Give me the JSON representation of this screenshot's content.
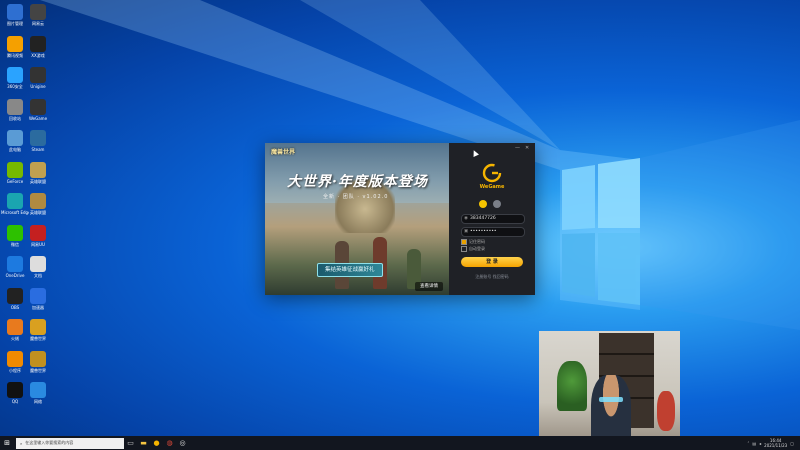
{
  "desktop": {
    "icons": [
      {
        "label": "图片管理",
        "icon": "image-icon",
        "color": "#2e6fd1"
      },
      {
        "label": "网易云",
        "icon": "tv-icon",
        "color": "#444"
      },
      {
        "label": "腾讯视频",
        "icon": "video-icon",
        "color": "#f5a000"
      },
      {
        "label": "XX游戏",
        "icon": "game-icon",
        "color": "#222"
      },
      {
        "label": "360安全",
        "icon": "shield-icon",
        "color": "#2aa3ff"
      },
      {
        "label": "Unigine",
        "icon": "app-icon",
        "color": "#333"
      },
      {
        "label": "回收站",
        "icon": "recycle-bin-icon",
        "color": "#888"
      },
      {
        "label": "WeGame",
        "icon": "wegame-icon",
        "color": "#333"
      },
      {
        "label": "此电脑",
        "icon": "computer-icon",
        "color": "#5a9bd5"
      },
      {
        "label": "Steam",
        "icon": "steam-icon",
        "color": "#2b6b9f"
      },
      {
        "label": "GeForce",
        "icon": "nvidia-icon",
        "color": "#76b900"
      },
      {
        "label": "英雄联盟",
        "icon": "lol-icon",
        "color": "#c0a050"
      },
      {
        "label": "Microsoft Edge",
        "icon": "edge-icon",
        "color": "#1aa5b0"
      },
      {
        "label": "英雄联盟",
        "icon": "lol-icon",
        "color": "#b08a40"
      },
      {
        "label": "微信",
        "icon": "wechat-icon",
        "color": "#2dc100"
      },
      {
        "label": "网易UU",
        "icon": "uu-icon",
        "color": "#c42020"
      },
      {
        "label": "OneDrive",
        "icon": "cloud-icon",
        "color": "#1d7ae0"
      },
      {
        "label": "文档",
        "icon": "doc-icon",
        "color": "#ddd"
      },
      {
        "label": "OBS",
        "icon": "obs-icon",
        "color": "#222"
      },
      {
        "label": "加速器",
        "icon": "accelerator-icon",
        "color": "#2a6de0"
      },
      {
        "label": "火绒",
        "icon": "fire-icon",
        "color": "#e87a1e"
      },
      {
        "label": "魔兽世界",
        "icon": "wow-icon",
        "color": "#d9a020"
      },
      {
        "label": "小程序",
        "icon": "app-icon",
        "color": "#f08a00"
      },
      {
        "label": "魔兽世界",
        "icon": "wow-icon",
        "color": "#c09020"
      },
      {
        "label": "QQ",
        "icon": "qq-icon",
        "color": "#111"
      },
      {
        "label": "网络",
        "icon": "network-icon",
        "color": "#2a8ae0"
      }
    ]
  },
  "login": {
    "banner_logo": "魔兽世界",
    "banner_title": "大世界·年度版本登场",
    "banner_subtitle": "全新 · 团队 · v1.02.0",
    "banner_promo": "集结英雄征战赢好礼",
    "banner_more": "查看详情",
    "brand": "WeGame",
    "account": "383447726",
    "password_mask": "••••••••••",
    "remember_label": "记住密码",
    "auto_login_label": "自动登录",
    "login_button": "登 录",
    "register_link": "注册账号  找回密码",
    "minimize": "—",
    "close": "✕",
    "accent": "#f5b400"
  },
  "taskbar": {
    "search_placeholder": "在这里输入你要搜索的内容",
    "clock_time": "16:44",
    "clock_date": "2021/11/23",
    "apps": [
      "file-explorer-icon",
      "wegame-icon",
      "chrome-icon",
      "obs-icon",
      "folder-icon",
      "media-icon"
    ]
  }
}
